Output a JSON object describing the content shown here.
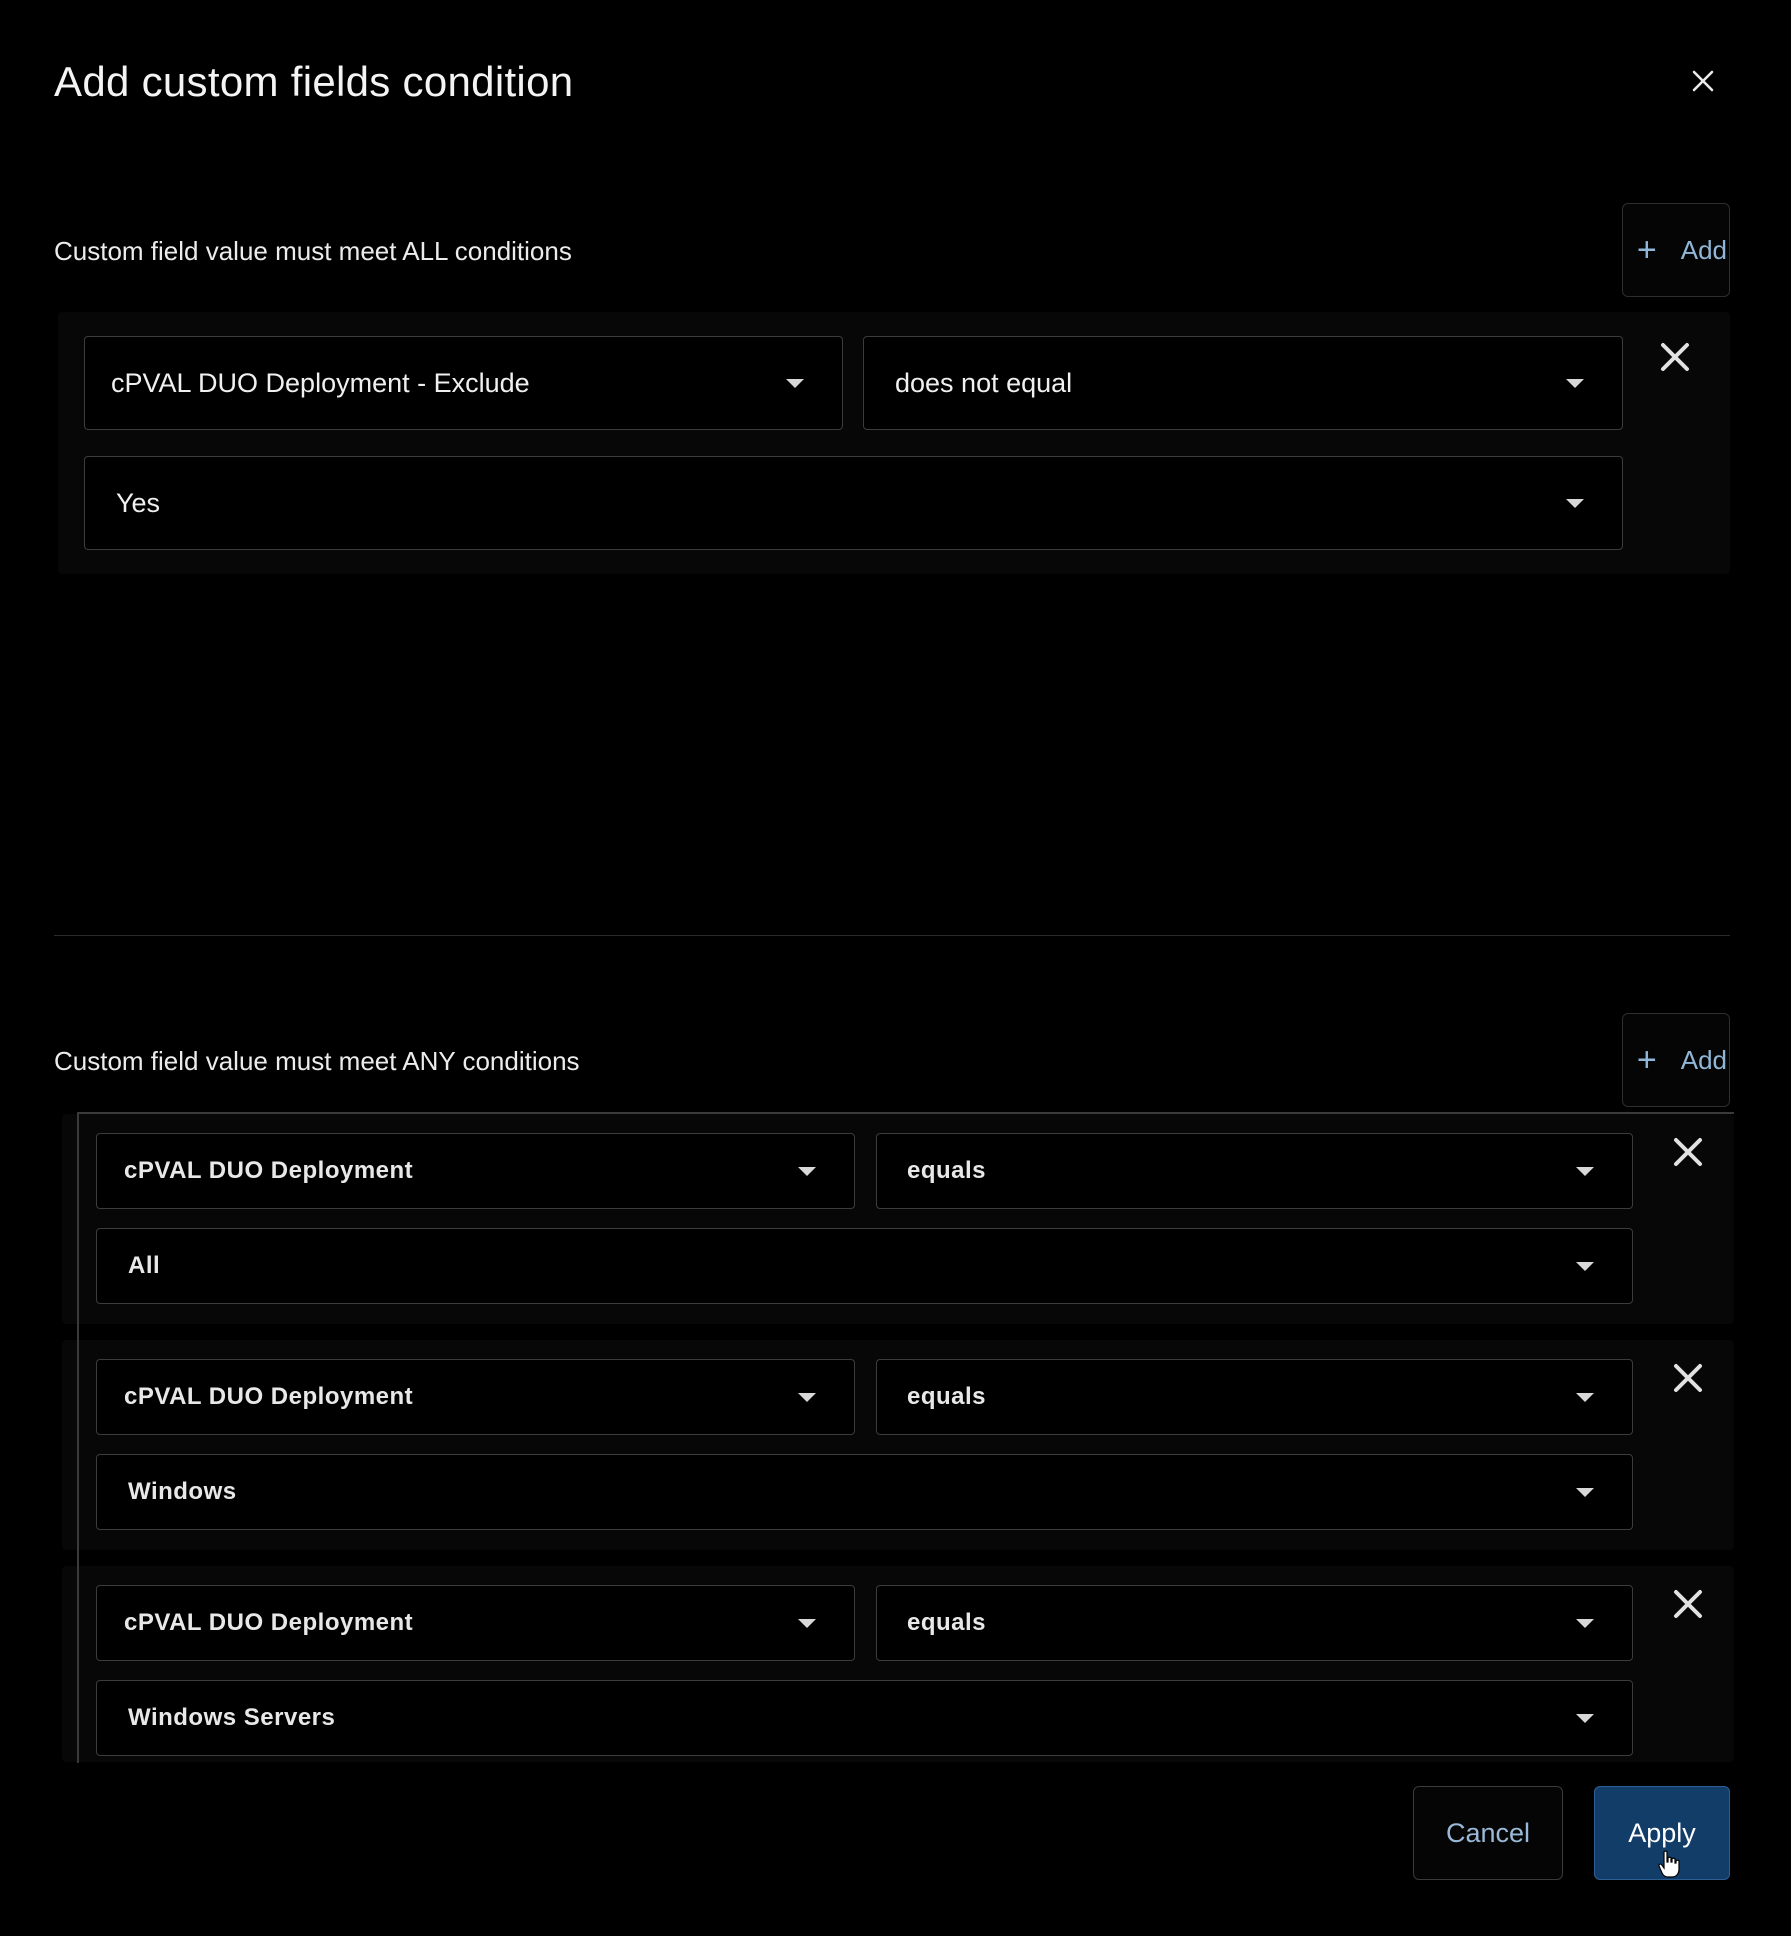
{
  "dialog": {
    "title": "Add custom fields condition",
    "close_icon": "close-icon"
  },
  "all_section": {
    "label": "Custom field value must meet ALL conditions",
    "add_label": "Add",
    "conditions": [
      {
        "field": "cPVAL DUO Deployment - Exclude",
        "operator": "does not equal",
        "value": "Yes"
      }
    ]
  },
  "any_section": {
    "label": "Custom field value must meet ANY conditions",
    "add_label": "Add",
    "conditions": [
      {
        "field": "cPVAL DUO Deployment",
        "operator": "equals",
        "value": "All"
      },
      {
        "field": "cPVAL DUO Deployment",
        "operator": "equals",
        "value": "Windows"
      },
      {
        "field": "cPVAL DUO Deployment",
        "operator": "equals",
        "value": "Windows Servers"
      }
    ]
  },
  "footer": {
    "cancel_label": "Cancel",
    "apply_label": "Apply"
  },
  "colors": {
    "background": "#000000",
    "accent_text": "#8fb6d6",
    "apply_bg": "#123d69"
  }
}
